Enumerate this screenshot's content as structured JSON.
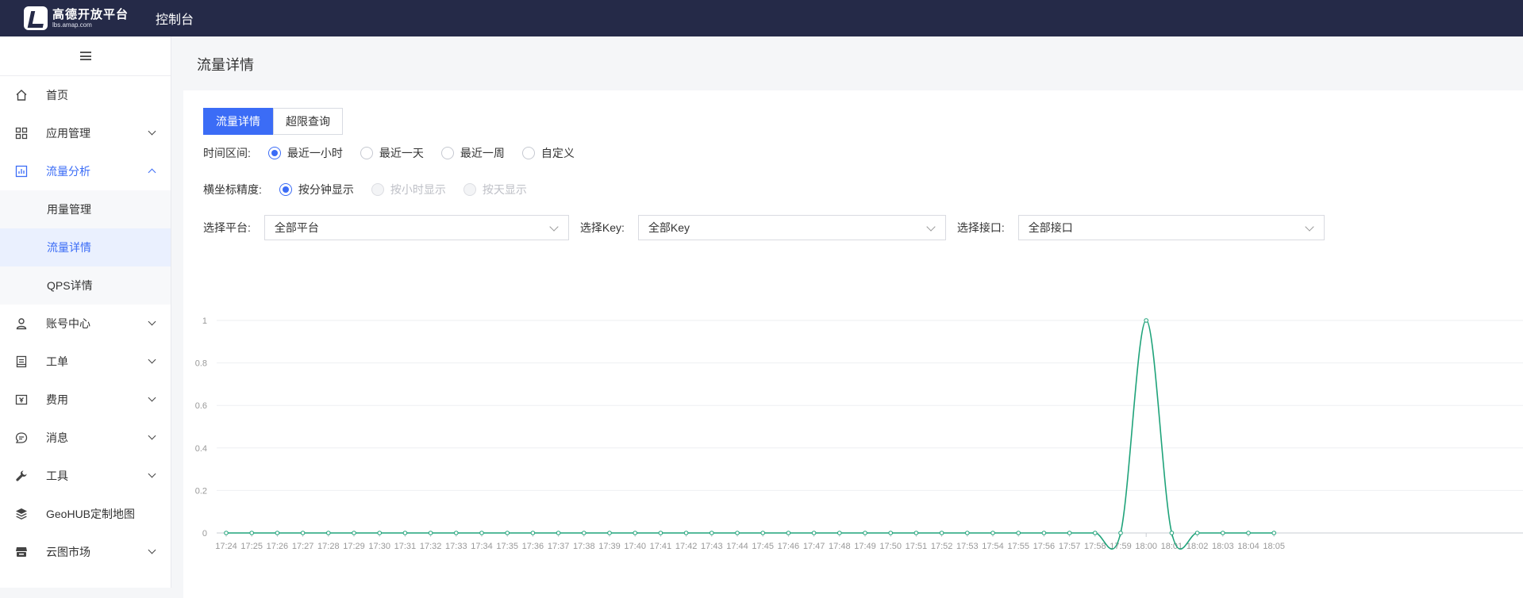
{
  "header": {
    "logo_cn": "高德开放平台",
    "logo_en": "lbs.amap.com",
    "title": "控制台"
  },
  "sidebar": {
    "items": [
      {
        "label": "首页",
        "icon": "home-icon",
        "expandable": false
      },
      {
        "label": "应用管理",
        "icon": "grid-icon",
        "expandable": true
      },
      {
        "label": "流量分析",
        "icon": "chart-icon",
        "expandable": true,
        "expanded": true,
        "children": [
          {
            "label": "用量管理"
          },
          {
            "label": "流量详情",
            "active": true
          },
          {
            "label": "QPS详情"
          }
        ]
      },
      {
        "label": "账号中心",
        "icon": "user-icon",
        "expandable": true
      },
      {
        "label": "工单",
        "icon": "ticket-icon",
        "expandable": true
      },
      {
        "label": "费用",
        "icon": "billing-icon",
        "expandable": true
      },
      {
        "label": "消息",
        "icon": "message-icon",
        "expandable": true
      },
      {
        "label": "工具",
        "icon": "wrench-icon",
        "expandable": true
      },
      {
        "label": "GeoHUB定制地图",
        "icon": "layers-icon",
        "expandable": false
      },
      {
        "label": "云图市场",
        "icon": "market-icon",
        "expandable": true
      }
    ]
  },
  "page": {
    "title": "流量详情",
    "tabs": [
      {
        "label": "流量详情",
        "active": true
      },
      {
        "label": "超限查询",
        "active": false
      }
    ],
    "time_range": {
      "label": "时间区间:",
      "options": [
        {
          "label": "最近一小时",
          "checked": true
        },
        {
          "label": "最近一天",
          "checked": false
        },
        {
          "label": "最近一周",
          "checked": false
        },
        {
          "label": "自定义",
          "checked": false
        }
      ]
    },
    "precision": {
      "label": "横坐标精度:",
      "options": [
        {
          "label": "按分钟显示",
          "checked": true,
          "disabled": false
        },
        {
          "label": "按小时显示",
          "checked": false,
          "disabled": true
        },
        {
          "label": "按天显示",
          "checked": false,
          "disabled": true
        }
      ]
    },
    "filters": {
      "platform_label": "选择平台:",
      "platform_value": "全部平台",
      "key_label": "选择Key:",
      "key_value": "全部Key",
      "api_label": "选择接口:",
      "api_value": "全部接口"
    }
  },
  "colors": {
    "accent": "#3b6cf6",
    "topbar": "#252a48",
    "line": "#1fa37a"
  },
  "chart_data": {
    "type": "line",
    "title": "",
    "xlabel": "",
    "ylabel": "",
    "ylim": [
      0,
      1
    ],
    "yticks": [
      0,
      0.2,
      0.4,
      0.6,
      0.8,
      1
    ],
    "grid": true,
    "x": [
      "17:24",
      "17:25",
      "17:26",
      "17:27",
      "17:28",
      "17:29",
      "17:30",
      "17:31",
      "17:32",
      "17:33",
      "17:34",
      "17:35",
      "17:36",
      "17:37",
      "17:38",
      "17:39",
      "17:40",
      "17:41",
      "17:42",
      "17:43",
      "17:44",
      "17:45",
      "17:46",
      "17:47",
      "17:48",
      "17:49",
      "17:50",
      "17:51",
      "17:52",
      "17:53",
      "17:54",
      "17:55",
      "17:56",
      "17:57",
      "17:58",
      "17:59",
      "18:00",
      "18:01",
      "18:02",
      "18:03",
      "18:04",
      "18:05"
    ],
    "series": [
      {
        "values": [
          0,
          0,
          0,
          0,
          0,
          0,
          0,
          0,
          0,
          0,
          0,
          0,
          0,
          0,
          0,
          0,
          0,
          0,
          0,
          0,
          0,
          0,
          0,
          0,
          0,
          0,
          0,
          0,
          0,
          0,
          0,
          0,
          0,
          0,
          0,
          0,
          1,
          0,
          0,
          0,
          0,
          0
        ]
      }
    ]
  }
}
